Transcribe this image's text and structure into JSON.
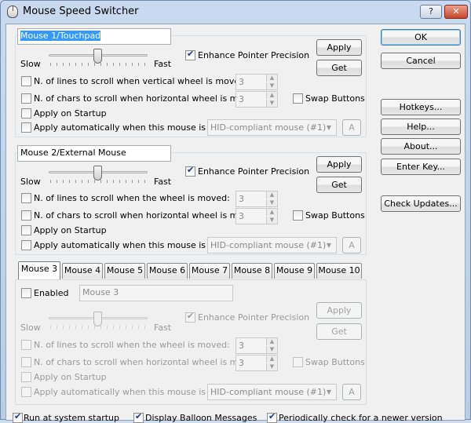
{
  "window": {
    "title": "Mouse Speed Switcher",
    "help_label": "?",
    "close_label": "✕"
  },
  "mouse1": {
    "name": "Mouse 1/Touchpad",
    "slow": "Slow",
    "fast": "Fast",
    "enhance": "Enhance Pointer Precision",
    "apply": "Apply",
    "get": "Get",
    "lines": "N. of lines to scroll when vertical wheel is moved:",
    "lines_value": "3",
    "chars": "N. of chars to scroll when  horizontal wheel is moved:",
    "chars_value": "3",
    "swap": "Swap Buttons",
    "startup": "Apply on Startup",
    "auto": "Apply automatically when this mouse is used:",
    "device": "HID-compliant mouse (#1)",
    "a_label": "A"
  },
  "mouse2": {
    "name": "Mouse 2/External Mouse",
    "slow": "Slow",
    "fast": "Fast",
    "enhance": "Enhance Pointer Precision",
    "apply": "Apply",
    "get": "Get",
    "lines": "N. of lines to scroll when the wheel is moved:",
    "lines_value": "3",
    "chars": "N. of chars to scroll when  horizontal wheel is moved:",
    "chars_value": "3",
    "swap": "Swap Buttons",
    "startup": "Apply on Startup",
    "auto": "Apply automatically when this mouse is used:",
    "device": "HID-compliant mouse (#1)",
    "a_label": "A"
  },
  "tabs": [
    "Mouse 3",
    "Mouse 4",
    "Mouse 5",
    "Mouse 6",
    "Mouse 7",
    "Mouse 8",
    "Mouse 9",
    "Mouse 10"
  ],
  "mouse3": {
    "enabled": "Enabled",
    "name": "Mouse 3",
    "slow": "Slow",
    "fast": "Fast",
    "enhance": "Enhance Pointer Precision",
    "apply": "Apply",
    "get": "Get",
    "lines": "N. of lines to scroll when the wheel is moved:",
    "lines_value": "3",
    "chars": "N. of chars to scroll when  horizontal wheel is moved:",
    "chars_value": "3",
    "swap": "Swap Buttons",
    "startup": "Apply on Startup",
    "auto": "Apply automatically when this mouse is used:",
    "device": "HID-compliant mouse (#1)",
    "a_label": "A"
  },
  "side": {
    "ok": "OK",
    "cancel": "Cancel",
    "hotkeys": "Hotkeys...",
    "help": "Help...",
    "about": "About...",
    "enter_key": "Enter Key...",
    "check_updates": "Check Updates..."
  },
  "footer": {
    "run_startup": "Run at system startup",
    "balloon": "Display Balloon Messages",
    "check_version": "Periodically check for a newer version"
  }
}
